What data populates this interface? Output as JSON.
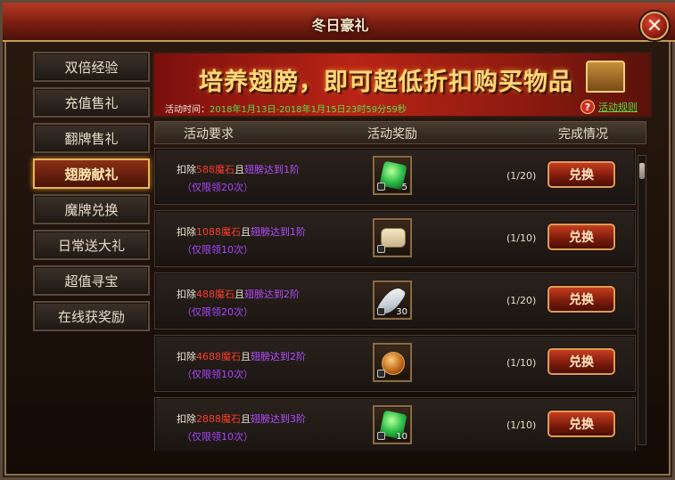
{
  "window": {
    "title": "冬日豪礼",
    "close_label": "✕"
  },
  "sidebar": {
    "items": [
      {
        "label": "双倍经验",
        "active": false
      },
      {
        "label": "充值售礼",
        "active": false
      },
      {
        "label": "翻牌售礼",
        "active": false
      },
      {
        "label": "翅膀献礼",
        "active": true
      },
      {
        "label": "魔牌兑换",
        "active": false
      },
      {
        "label": "日常送大礼",
        "active": false
      },
      {
        "label": "超值寻宝",
        "active": false
      },
      {
        "label": "在线获奖励",
        "active": false
      }
    ]
  },
  "banner": {
    "title": "培养翅膀，即可超低折扣购买物品",
    "time_label": "活动时间：",
    "time_value": "2018年1月13日-2018年1月15日23时59分59秒",
    "rules_label": "活动规则",
    "help_icon": "?"
  },
  "table": {
    "headers": {
      "requirement": "活动要求",
      "reward": "活动奖励",
      "status": "完成情况"
    },
    "rows": [
      {
        "prefix": "扣除",
        "cost": "588魔石",
        "mid": "且",
        "wing": "翅膀达到1阶",
        "limit": "（仅限领20次）",
        "item_icon": "green-gem-icon",
        "count": "5",
        "progress": "(1/20)",
        "button": "兑换"
      },
      {
        "prefix": "扣除",
        "cost": "1088魔石",
        "mid": "且",
        "wing": "翅膀达到1阶",
        "limit": "（仅限领10次）",
        "item_icon": "scroll-icon",
        "count": "",
        "progress": "(1/10)",
        "button": "兑换"
      },
      {
        "prefix": "扣除",
        "cost": "488魔石",
        "mid": "且",
        "wing": "翅膀达到2阶",
        "limit": "（仅限领20次）",
        "item_icon": "feather-icon",
        "count": "30",
        "progress": "(1/20)",
        "button": "兑换"
      },
      {
        "prefix": "扣除",
        "cost": "4688魔石",
        "mid": "且",
        "wing": "翅膀达到2阶",
        "limit": "（仅限领10次）",
        "item_icon": "coin-icon",
        "count": "",
        "progress": "(1/10)",
        "button": "兑换"
      },
      {
        "prefix": "扣除",
        "cost": "2888魔石",
        "mid": "且",
        "wing": "翅膀达到3阶",
        "limit": "（仅限领10次）",
        "item_icon": "green-gem-icon",
        "count": "10",
        "progress": "(1/10)",
        "button": "兑换"
      }
    ]
  },
  "colors": {
    "accent_red": "#ff3b2a",
    "accent_green": "#56e043",
    "accent_purple": "#b34cff",
    "gold": "#ffd978"
  }
}
